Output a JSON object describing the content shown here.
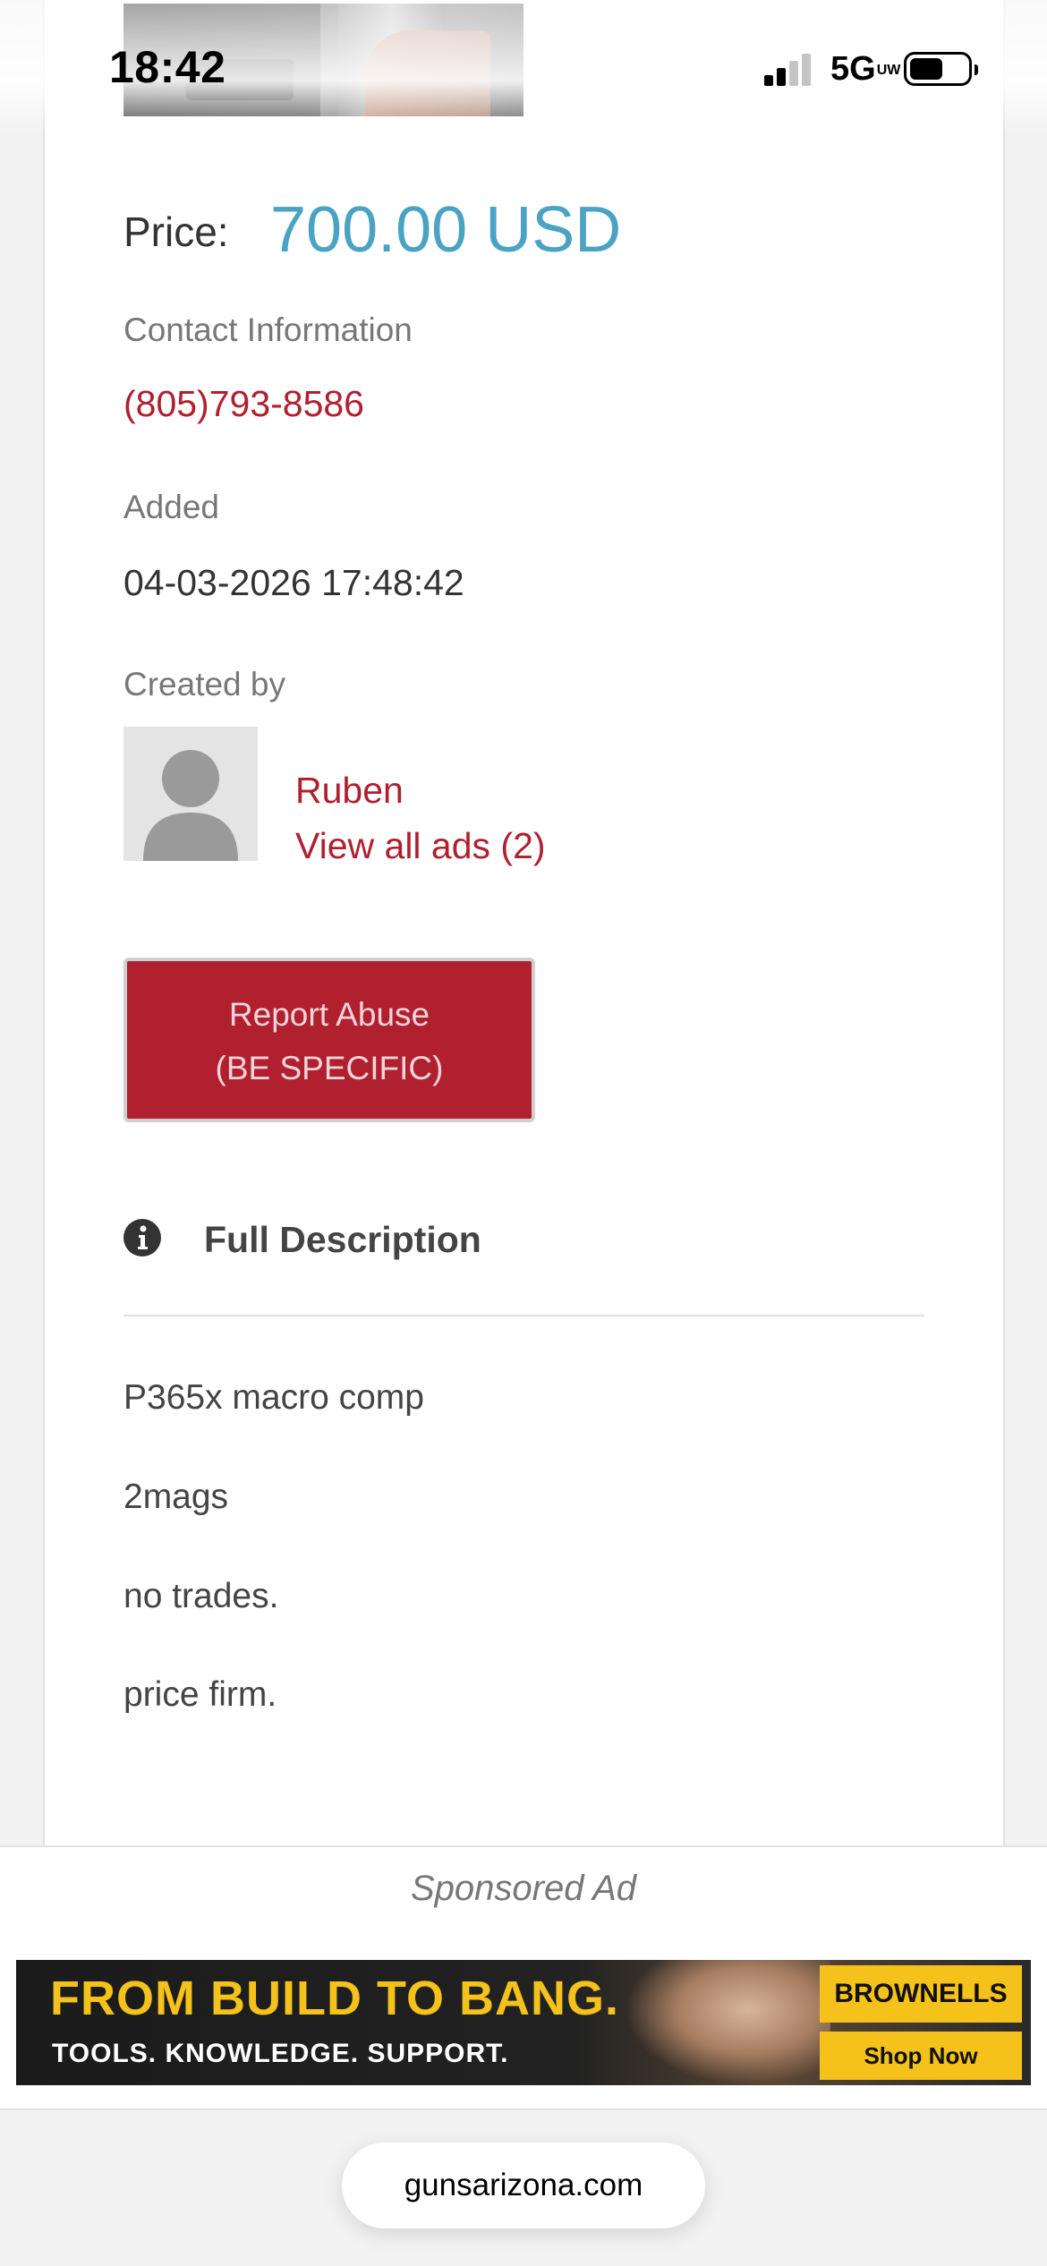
{
  "status_bar": {
    "time": "18:42",
    "network": "5G",
    "network_sub": "UW"
  },
  "listing": {
    "price_label": "Price:",
    "price_value": "700.00 USD",
    "contact_label": "Contact Information",
    "phone": "(805)793-8586",
    "added_label": "Added",
    "added_value": "04-03-2026 17:48:42",
    "created_by_label": "Created by",
    "author_name": "Ruben",
    "view_ads_label": "View all ads (2)",
    "report_line1": "Report Abuse",
    "report_line2": "(BE SPECIFIC)",
    "description_title": "Full Description",
    "description_lines": [
      "P365x macro comp",
      "2mags",
      "no trades.",
      "price firm."
    ]
  },
  "sponsored": {
    "label": "Sponsored Ad",
    "headline": "FROM BUILD TO BANG.",
    "subline": "TOOLS. KNOWLEDGE. SUPPORT.",
    "brand": "BROWNELLS",
    "cta": "Shop Now"
  },
  "browser": {
    "url": "gunsarizona.com"
  }
}
